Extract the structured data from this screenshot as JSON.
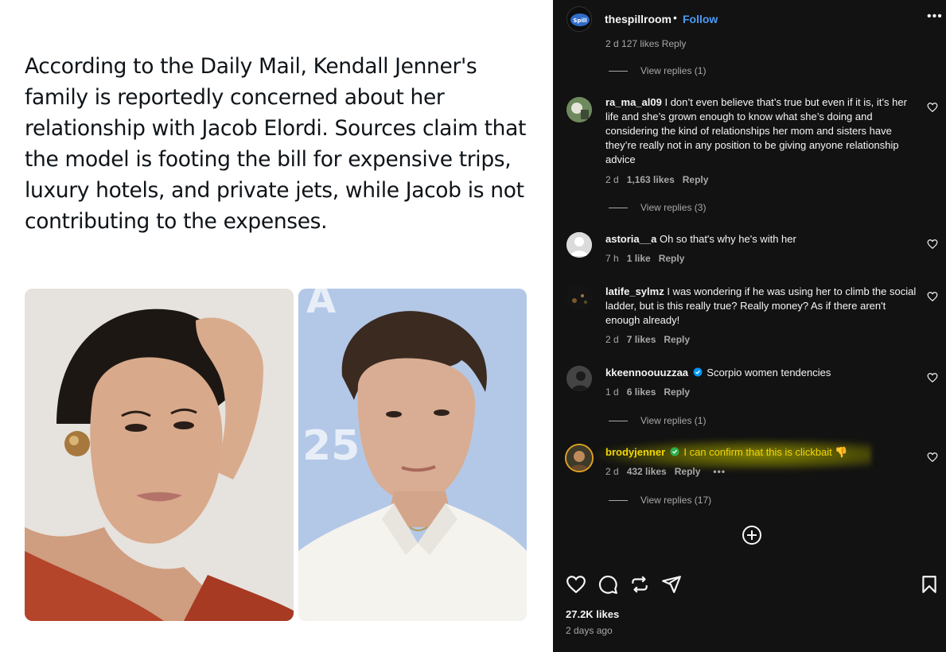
{
  "tweet": {
    "text": "According to the Daily Mail, Kendall Jenner's family is reportedly concerned about her relationship with Jacob Elordi. Sources claim that the model is footing the bill for expensive trips, luxury hotels, and private jets, while Jacob is not contributing to the expenses.",
    "images": [
      "photo-kendall",
      "photo-jacob"
    ]
  },
  "post": {
    "username": "thespillroom",
    "separator": "•",
    "follow_label": "Follow",
    "more_label": "•••",
    "cut_meta": "2 d   127 likes   Reply"
  },
  "comments": [
    {
      "username": "ra_ma_al09",
      "text": "I don’t even believe that’s true but even if it is, it’s her life and she’s grown enough to know what she’s doing and considering the kind of relationships her mom and sisters have they’re really not in any position to be giving anyone relationship advice",
      "time": "2 d",
      "likes": "1,163 likes",
      "reply": "Reply",
      "view_replies": "View replies (3)"
    },
    {
      "username": "astoria__a",
      "text": "Oh so that's why he's with her",
      "time": "7 h",
      "likes": "1 like",
      "reply": "Reply"
    },
    {
      "username": "latife_sylmz",
      "text": "I was wondering if he was using her to climb the social ladder, but is this really true? Really money? As if there aren't enough already!",
      "time": "2 d",
      "likes": "7 likes",
      "reply": "Reply"
    },
    {
      "username": "kkeennoouuzzaa",
      "text": "Scorpio women tendencies",
      "time": "1 d",
      "likes": "6 likes",
      "reply": "Reply",
      "view_replies": "View replies (1)"
    },
    {
      "username": "brodyjenner",
      "text": "I can confirm that this is clickbait 👎",
      "time": "2 d",
      "likes": "432 likes",
      "reply": "Reply",
      "more": "•••",
      "view_replies": "View replies (17)"
    }
  ],
  "top_view_replies": "View replies (1)",
  "footer": {
    "likes": "27.2K likes",
    "date": "2 days ago"
  },
  "colors": {
    "panel_bg": "#121212",
    "accent": "#4a9cf6",
    "highlight": "#f3d600",
    "verified": "#0095f6"
  }
}
